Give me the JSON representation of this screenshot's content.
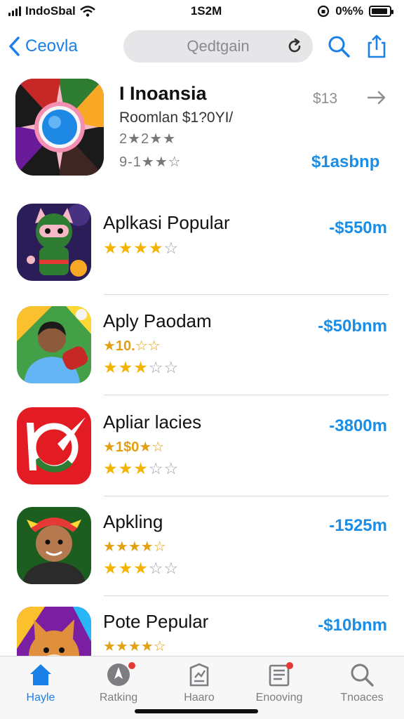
{
  "status_bar": {
    "carrier": "IndoSbal",
    "time": "1S2M",
    "battery_text": "0%%",
    "battery_level": 0.9
  },
  "nav": {
    "back_label": "Ceovla",
    "search_text": "Qedtgain"
  },
  "featured": {
    "title": "I Inoansia",
    "subtitle": "Roomlan $1?0YI/",
    "rating_line1": "2★2★★",
    "rating_line2": "9-1★★☆",
    "price_top": "$13",
    "price_bottom": "$1asbnp"
  },
  "apps": [
    {
      "name": "Aplkasi Popular",
      "line1": "",
      "stars": 4,
      "price": "-$550m"
    },
    {
      "name": "Aply Paodam",
      "line1": "★10.☆☆",
      "stars": 3,
      "price": "-$50bnm"
    },
    {
      "name": "Apliar lacies",
      "line1": "★1$0★☆",
      "stars": 3.5,
      "price": "-3800m"
    },
    {
      "name": "Apkling",
      "line1": "★★★★☆",
      "stars": 3,
      "price": "-1525m"
    },
    {
      "name": "Pote Pepular",
      "line1": "★★★★☆",
      "stars": 0,
      "price": "-$10bnm"
    }
  ],
  "tabs": [
    {
      "label": "Hayle",
      "icon": "home-icon",
      "active": true
    },
    {
      "label": "Ratking",
      "icon": "compass-icon",
      "badge": true
    },
    {
      "label": "Haaro",
      "icon": "chart-icon"
    },
    {
      "label": "Enooving",
      "icon": "document-icon",
      "badge": true
    },
    {
      "label": "Tnoaces",
      "icon": "search-icon"
    }
  ],
  "colors": {
    "accent": "#1a7fe6",
    "price": "#1a8ee6",
    "star": "#f5b301",
    "badge": "#e53935"
  }
}
